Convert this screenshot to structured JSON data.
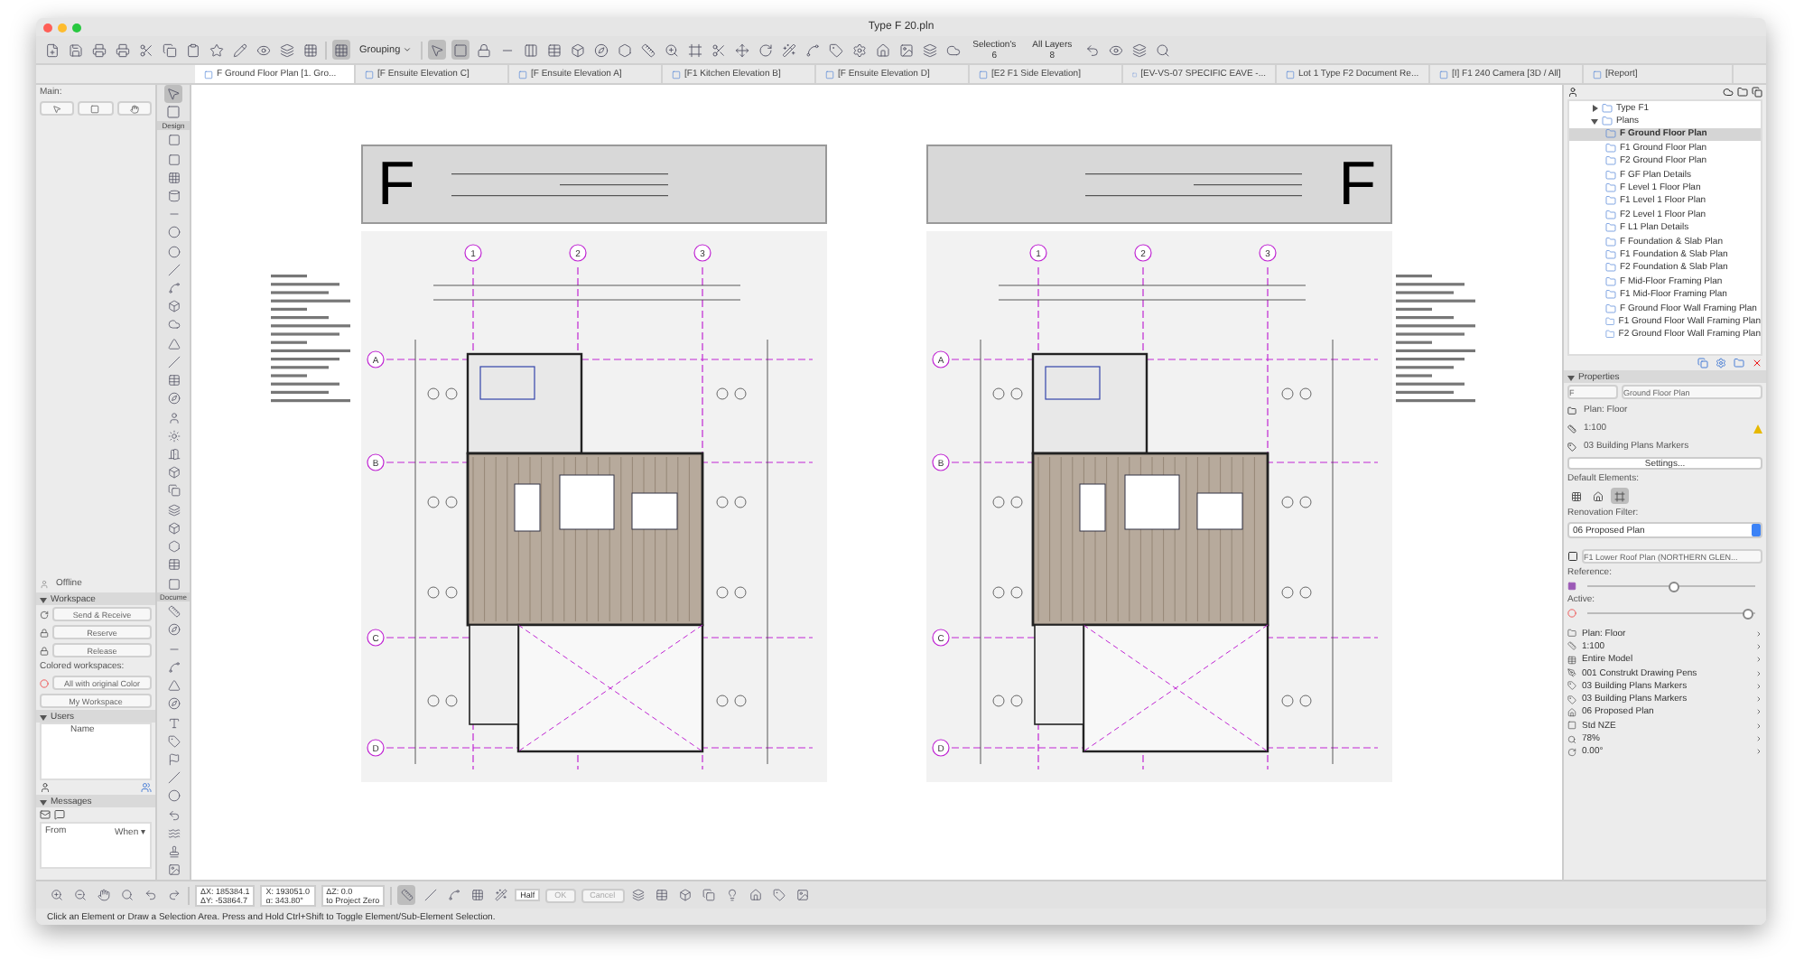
{
  "window": {
    "title": "Type F 20.pln"
  },
  "toolbar": {
    "grouping": "Grouping",
    "selection_label": "Selection's",
    "selection_count": "6",
    "layers_label": "All Layers",
    "layers_count": "8"
  },
  "tabs": [
    {
      "label": "F Ground Floor Plan [1. Gro...",
      "selected": true
    },
    {
      "label": "[F Ensuite Elevation C]",
      "selected": false
    },
    {
      "label": "[F Ensuite Elevation A]",
      "selected": false
    },
    {
      "label": "[F1 Kitchen Elevation B]",
      "selected": false
    },
    {
      "label": "[F Ensuite Elevation D]",
      "selected": false
    },
    {
      "label": "[E2 F1 Side Elevation]",
      "selected": false
    },
    {
      "label": "[EV-VS-07 SPECIFIC EAVE -...",
      "selected": false
    },
    {
      "label": "Lot 1 Type F2 Document Re...",
      "selected": false
    },
    {
      "label": "[I] F1 240 Camera [3D / All]",
      "selected": false
    },
    {
      "label": "[Report]",
      "selected": false
    }
  ],
  "left_panel": {
    "title": "Main:",
    "status": "Offline",
    "workspace": {
      "title": "Workspace",
      "expanded": true,
      "send": "Send & Receive",
      "reserve": "Reserve",
      "release": "Release",
      "colored_label": "Colored workspaces:",
      "color_mode": "All with original Color",
      "my_workspace": "My Workspace"
    },
    "users": {
      "title": "Users",
      "expanded": true,
      "column": "Name"
    },
    "messages": {
      "title": "Messages",
      "expanded": true,
      "columns": [
        "From",
        "When ▾"
      ]
    }
  },
  "toolbox": {
    "sections": [
      "Design",
      "Docume"
    ]
  },
  "sheets": [
    {
      "letter": "F",
      "grid_columns": [
        "1",
        "2",
        "3"
      ],
      "grid_rows": [
        "A",
        "B",
        "C",
        "D"
      ]
    },
    {
      "letter": "F",
      "grid_columns": [
        "1",
        "2",
        "3"
      ],
      "grid_rows": [
        "A",
        "B",
        "C",
        "D"
      ]
    }
  ],
  "navigator": {
    "tree": [
      {
        "label": "Type F1",
        "expanded": false,
        "selected": false
      },
      {
        "label": "Plans",
        "expanded": true,
        "selected": false,
        "children": [
          {
            "label": "F Ground Floor Plan",
            "selected": true
          },
          {
            "label": "F1 Ground Floor Plan",
            "selected": false
          },
          {
            "label": "F2 Ground Floor Plan",
            "selected": false
          },
          {
            "label": "F GF Plan Details",
            "selected": false
          },
          {
            "label": "F Level 1 Floor Plan",
            "selected": false
          },
          {
            "label": "F1 Level 1 Floor Plan",
            "selected": false
          },
          {
            "label": "F2 Level 1 Floor Plan",
            "selected": false
          },
          {
            "label": "F L1 Plan Details",
            "selected": false
          },
          {
            "label": "F Foundation & Slab Plan",
            "selected": false
          },
          {
            "label": "F1 Foundation & Slab Plan",
            "selected": false
          },
          {
            "label": "F2 Foundation & Slab Plan",
            "selected": false
          },
          {
            "label": "F Mid-Floor Framing Plan",
            "selected": false
          },
          {
            "label": "F1 Mid-Floor Framing Plan",
            "selected": false
          },
          {
            "label": "F Ground Floor Wall Framing Plan",
            "selected": false
          },
          {
            "label": "F1 Ground Floor Wall Framing Plan",
            "selected": false
          },
          {
            "label": "F2 Ground Floor Wall Framing Plan",
            "selected": false
          }
        ]
      }
    ]
  },
  "properties": {
    "title": "Properties",
    "expanded": true,
    "id": "F",
    "name": "Ground Floor Plan",
    "type": "Plan: Floor",
    "scale": "1:100",
    "markers": "03 Building Plans Markers",
    "settings": "Settings...",
    "default_label": "Default Elements:",
    "default_elements": [
      {
        "selected": false
      },
      {
        "selected": false
      },
      {
        "selected": true
      }
    ],
    "renovation_label": "Renovation Filter:",
    "renovation": "06 Proposed Plan"
  },
  "view": {
    "name": "F1 Lower Roof Plan (NORTHERN GLEN...",
    "reference": {
      "label": "Reference:",
      "level": 0.5
    },
    "active": {
      "label": "Active:",
      "level": 0.95
    }
  },
  "quick_options": [
    "Plan: Floor",
    "1:100",
    "Entire Model",
    "001 Construkt Drawing Pens",
    "03 Building Plans Markers",
    "03 Building Plans Markers",
    "06 Proposed Plan",
    "Std NZE",
    "78%",
    "0.00°"
  ],
  "coords": {
    "dx": "ΔX: 185384.1",
    "dy": "ΔY: -53864.7",
    "x": "X: 193051.0",
    "a": "α: 343.80°",
    "z": "ΔZ: 0.0",
    "ref": "to Project Zero"
  },
  "actions": [
    {
      "label": "OK",
      "disabled": true
    },
    {
      "label": "Cancel",
      "disabled": true
    }
  ],
  "half": "Half",
  "status": "Click an Element or Draw a Selection Area. Press and Hold Ctrl+Shift to Toggle Element/Sub-Element Selection."
}
